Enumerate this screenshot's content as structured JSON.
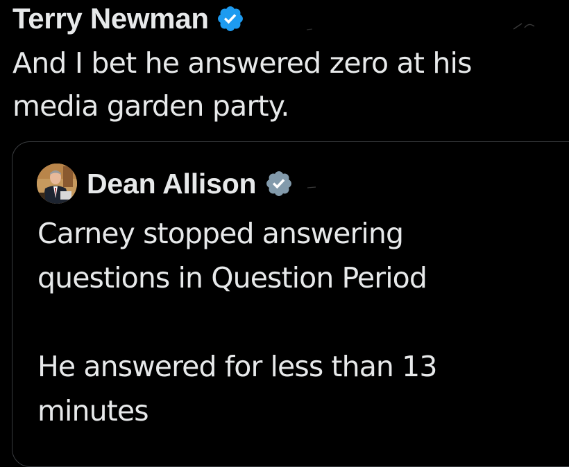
{
  "tweet": {
    "author_name": "Terry Newman",
    "text_line1": "And I bet he answered zero at his",
    "text_line2": "media garden party."
  },
  "quote": {
    "author_name": "Dean Allison",
    "para1_line1": "Carney stopped answering",
    "para1_line2": "questions in Question Period",
    "para2_line1": "He answered for less than 13",
    "para2_line2": "minutes"
  },
  "colors": {
    "background": "#000000",
    "text": "#e7e9ea",
    "verified_blue": "#1d9bf0",
    "verified_grey": "#829aab",
    "card_border": "#3a3d40"
  },
  "icons": {
    "primary_badge": "verified-badge-icon",
    "quote_badge": "government-verified-badge-icon"
  }
}
